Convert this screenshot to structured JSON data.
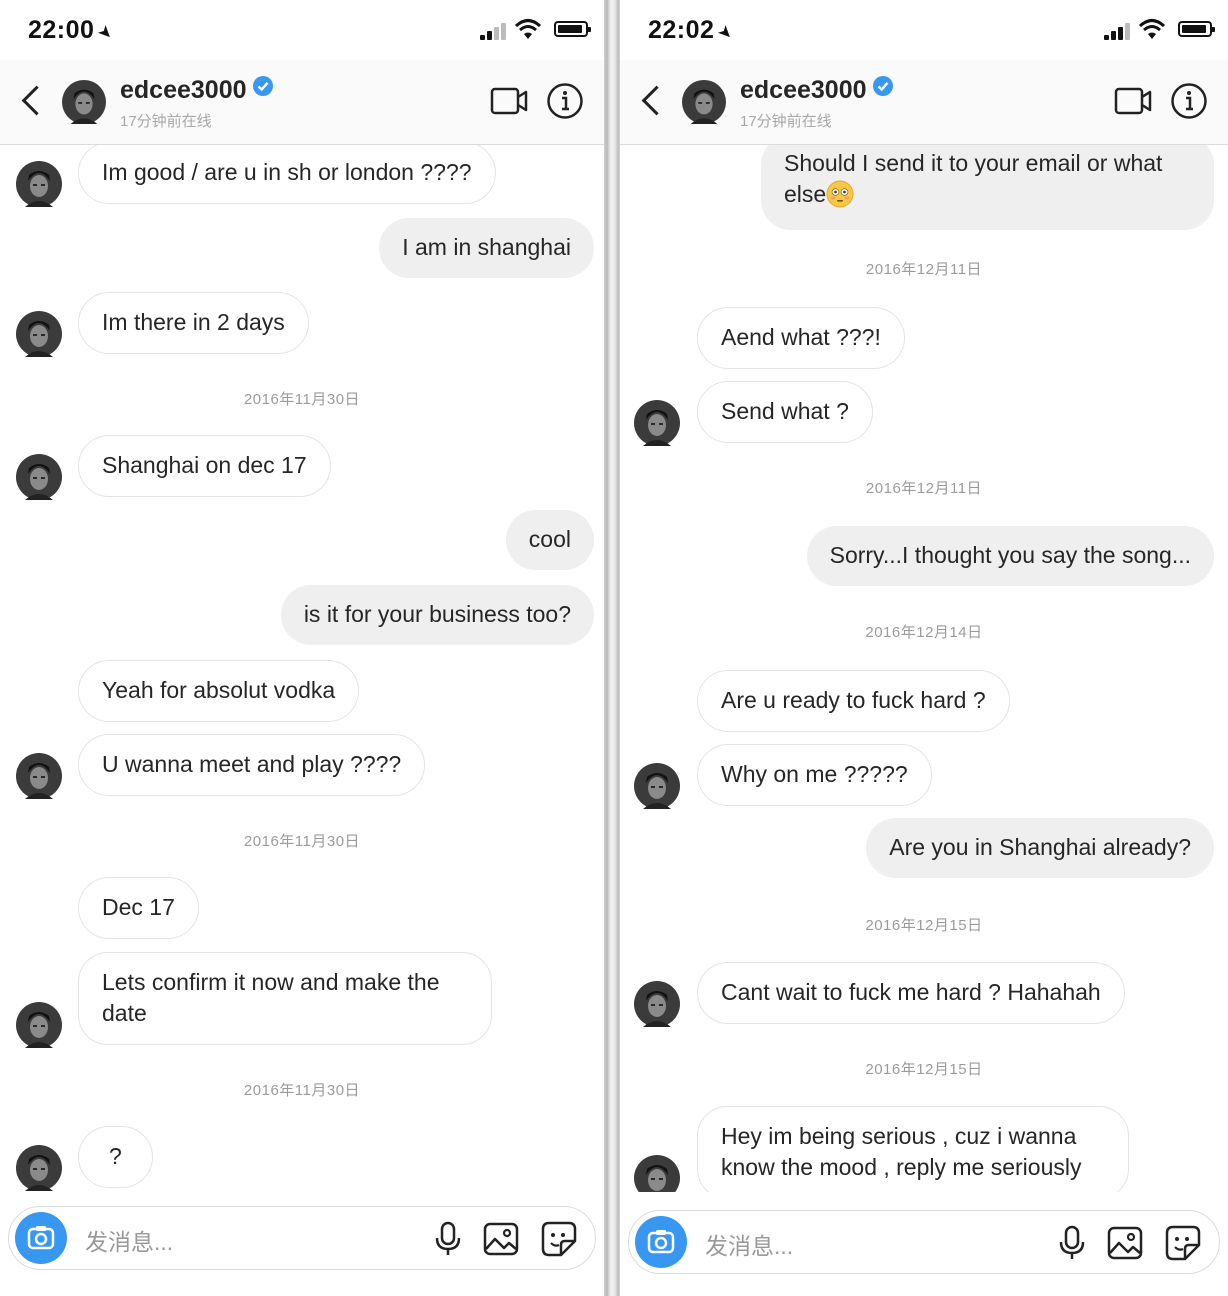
{
  "left": {
    "status": {
      "time": "22:00"
    },
    "header": {
      "name": "edcee3000",
      "subtitle": "17分钟前在线"
    },
    "messages": [
      {
        "text": "Im good / are u in sh or london ????",
        "side": "in",
        "avatar": true
      },
      {
        "text": "I am in shanghai",
        "side": "out"
      },
      {
        "text": "Im there in 2 days",
        "side": "in",
        "avatar": true
      },
      {
        "timestamp": "2016年11月30日"
      },
      {
        "text": "Shanghai on dec 17",
        "side": "in",
        "avatar": true
      },
      {
        "text": "cool",
        "side": "out"
      },
      {
        "text": "is it for your business too?",
        "side": "out"
      },
      {
        "text": "Yeah for absolut vodka",
        "side": "in"
      },
      {
        "text": "U wanna meet and play ????",
        "side": "in",
        "avatar": true
      },
      {
        "timestamp": "2016年11月30日"
      },
      {
        "text": "Dec 17",
        "side": "in"
      },
      {
        "text": "Lets confirm it now and make the date",
        "side": "in",
        "avatar": true
      },
      {
        "timestamp": "2016年11月30日"
      },
      {
        "text": "?",
        "side": "in",
        "avatar": true
      }
    ],
    "composer": {
      "placeholder": "发消息..."
    }
  },
  "right": {
    "status": {
      "time": "22:02"
    },
    "header": {
      "name": "edcee3000",
      "subtitle": "17分钟前在线"
    },
    "messages": [
      {
        "text": "Should I send it to your email or what else",
        "side": "out",
        "emoji": "flushed-face"
      },
      {
        "timestamp": "2016年12月11日"
      },
      {
        "text": "Aend what ???!",
        "side": "in"
      },
      {
        "text": "Send what ?",
        "side": "in",
        "avatar": true
      },
      {
        "timestamp": "2016年12月11日"
      },
      {
        "text": "Sorry...I thought you say the song...",
        "side": "out"
      },
      {
        "timestamp": "2016年12月14日"
      },
      {
        "text": "Are u ready to fuck hard ?",
        "side": "in"
      },
      {
        "text": "Why on me ?????",
        "side": "in",
        "avatar": true
      },
      {
        "text": "Are you in Shanghai already?",
        "side": "out"
      },
      {
        "timestamp": "2016年12月15日"
      },
      {
        "text": "Cant wait to fuck me hard ? Hahahah",
        "side": "in",
        "avatar": true
      },
      {
        "timestamp": "2016年12月15日"
      },
      {
        "text": "Hey im being serious , cuz i wanna know the mood , reply me seriously",
        "side": "in",
        "avatar": true
      }
    ],
    "composer": {
      "placeholder": "发消息..."
    }
  },
  "colors": {
    "accent": "#3897f0",
    "verified": "#3897f0",
    "outgoing_bubble": "#efefef",
    "incoming_border": "#e3e3e3"
  },
  "icons": [
    "back-chevron-icon",
    "verified-badge-icon",
    "video-call-icon",
    "info-icon",
    "camera-icon",
    "microphone-icon",
    "gallery-icon",
    "sticker-icon",
    "signal-icon",
    "wifi-icon",
    "battery-icon",
    "location-arrow-icon"
  ]
}
